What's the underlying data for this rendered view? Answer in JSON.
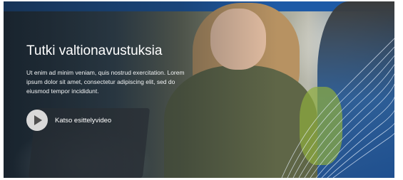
{
  "hero": {
    "title": "Tutki valtionavustuksia",
    "lead": "Ut enim ad minim veniam, quis nostrud exercitation. Lorem ipsum dolor sit amet, consectetur adipiscing elit, sed do eiusmod tempor incididunt.",
    "video_label": "Katso esittelyvideo",
    "icons": {
      "play": "play-icon"
    },
    "colors": {
      "accent": "#1e5aa6",
      "text": "#ffffff",
      "play_bg": "#d9d9d9"
    }
  }
}
